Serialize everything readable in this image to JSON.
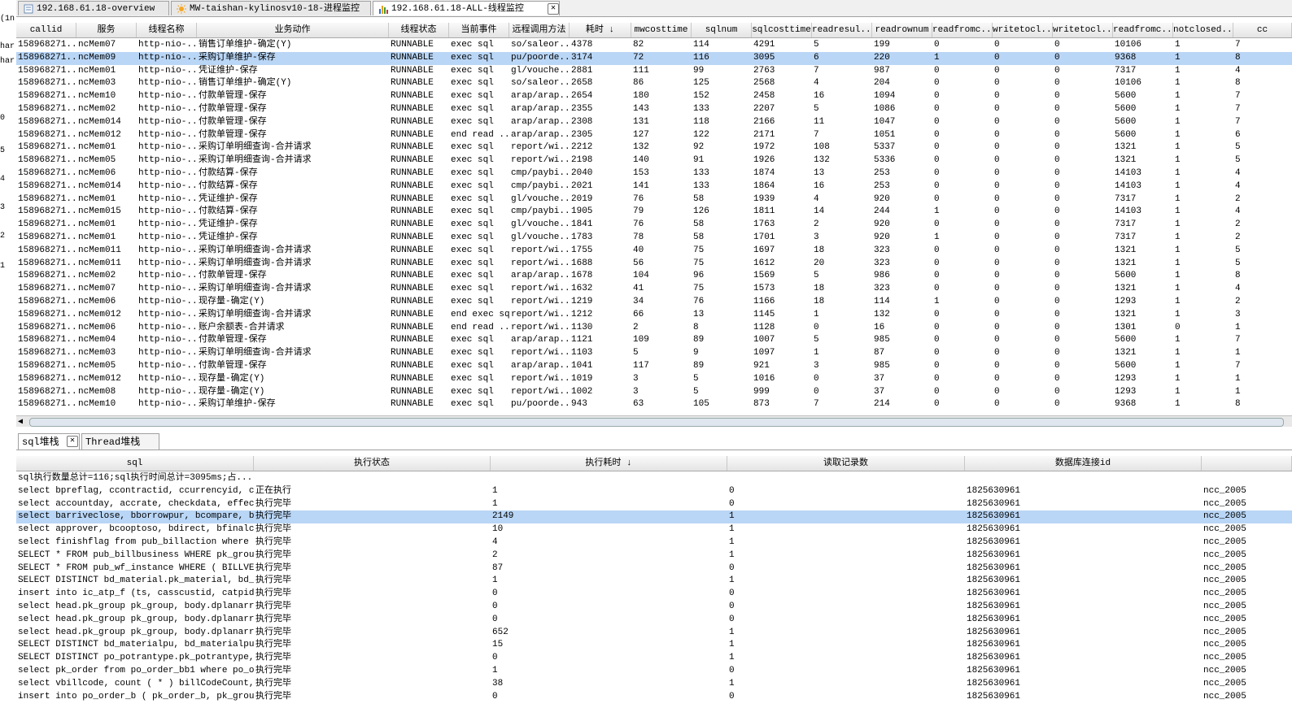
{
  "left_strip": [
    "(1n",
    "har",
    "har",
    "0",
    "5",
    "4",
    "3",
    "2",
    "1"
  ],
  "top_tabs": [
    {
      "label": "192.168.61.18-overview",
      "icon": "overview-icon",
      "active": false
    },
    {
      "label": "MW-taishan-kylinosv10-18-进程监控",
      "icon": "sun-icon",
      "active": false
    },
    {
      "label": "192.168.61.18-ALL-线程监控",
      "icon": "bar-chart-icon",
      "active": true
    }
  ],
  "thread_table": {
    "headers": [
      "callid",
      "服务",
      "线程名称",
      "业务动作",
      "线程状态",
      "当前事件",
      "远程调用方法",
      "耗时 ↓",
      "mwcosttime",
      "sqlnum",
      "sqlcosttime",
      "readresul...",
      "readrownum",
      "readfromc...",
      "writetocl...",
      "writetocl...",
      "readfromc...",
      "notclosed...",
      "cc"
    ],
    "rows": [
      [
        "158968271...",
        "ncMem07",
        "http-nio-...",
        "销售订单维护-确定(Y)",
        "RUNNABLE",
        "exec sql",
        "so/saleor...",
        "4378",
        "82",
        "114",
        "4291",
        "5",
        "199",
        "0",
        "0",
        "0",
        "10106",
        "1",
        "7"
      ],
      [
        "158968271...",
        "ncMem09",
        "http-nio-...",
        "采购订单维护-保存",
        "RUNNABLE",
        "exec sql",
        "pu/poorde...",
        "3174",
        "72",
        "116",
        "3095",
        "6",
        "220",
        "1",
        "0",
        "0",
        "9368",
        "1",
        "8"
      ],
      [
        "158968271...",
        "ncMem01",
        "http-nio-...",
        "凭证维护-保存",
        "RUNNABLE",
        "exec sql",
        "gl/vouche...",
        "2881",
        "111",
        "99",
        "2763",
        "7",
        "987",
        "0",
        "0",
        "0",
        "7317",
        "1",
        "4"
      ],
      [
        "158968271...",
        "ncMem03",
        "http-nio-...",
        "销售订单维护-确定(Y)",
        "RUNNABLE",
        "exec sql",
        "so/saleor...",
        "2658",
        "86",
        "125",
        "2568",
        "4",
        "204",
        "0",
        "0",
        "0",
        "10106",
        "1",
        "8"
      ],
      [
        "158968271...",
        "ncMem10",
        "http-nio-...",
        "付款单管理-保存",
        "RUNNABLE",
        "exec sql",
        "arap/arap...",
        "2654",
        "180",
        "152",
        "2458",
        "16",
        "1094",
        "0",
        "0",
        "0",
        "5600",
        "1",
        "7"
      ],
      [
        "158968271...",
        "ncMem02",
        "http-nio-...",
        "付款单管理-保存",
        "RUNNABLE",
        "exec sql",
        "arap/arap...",
        "2355",
        "143",
        "133",
        "2207",
        "5",
        "1086",
        "0",
        "0",
        "0",
        "5600",
        "1",
        "7"
      ],
      [
        "158968271...",
        "ncMem014",
        "http-nio-...",
        "付款单管理-保存",
        "RUNNABLE",
        "exec sql",
        "arap/arap...",
        "2308",
        "131",
        "118",
        "2166",
        "11",
        "1047",
        "0",
        "0",
        "0",
        "5600",
        "1",
        "7"
      ],
      [
        "158968271...",
        "ncMem012",
        "http-nio-...",
        "付款单管理-保存",
        "RUNNABLE",
        "end read ...",
        "arap/arap...",
        "2305",
        "127",
        "122",
        "2171",
        "7",
        "1051",
        "0",
        "0",
        "0",
        "5600",
        "1",
        "6"
      ],
      [
        "158968271...",
        "ncMem01",
        "http-nio-...",
        "采购订单明细查询-合并请求",
        "RUNNABLE",
        "exec sql",
        "report/wi...",
        "2212",
        "132",
        "92",
        "1972",
        "108",
        "5337",
        "0",
        "0",
        "0",
        "1321",
        "1",
        "5"
      ],
      [
        "158968271...",
        "ncMem05",
        "http-nio-...",
        "采购订单明细查询-合并请求",
        "RUNNABLE",
        "exec sql",
        "report/wi...",
        "2198",
        "140",
        "91",
        "1926",
        "132",
        "5336",
        "0",
        "0",
        "0",
        "1321",
        "1",
        "5"
      ],
      [
        "158968271...",
        "ncMem06",
        "http-nio-...",
        "付款结算-保存",
        "RUNNABLE",
        "exec sql",
        "cmp/paybi...",
        "2040",
        "153",
        "133",
        "1874",
        "13",
        "253",
        "0",
        "0",
        "0",
        "14103",
        "1",
        "4"
      ],
      [
        "158968271...",
        "ncMem014",
        "http-nio-...",
        "付款结算-保存",
        "RUNNABLE",
        "exec sql",
        "cmp/paybi...",
        "2021",
        "141",
        "133",
        "1864",
        "16",
        "253",
        "0",
        "0",
        "0",
        "14103",
        "1",
        "4"
      ],
      [
        "158968271...",
        "ncMem01",
        "http-nio-...",
        "凭证维护-保存",
        "RUNNABLE",
        "exec sql",
        "gl/vouche...",
        "2019",
        "76",
        "58",
        "1939",
        "4",
        "920",
        "0",
        "0",
        "0",
        "7317",
        "1",
        "2"
      ],
      [
        "158968271...",
        "ncMem015",
        "http-nio-...",
        "付款结算-保存",
        "RUNNABLE",
        "exec sql",
        "cmp/paybi...",
        "1905",
        "79",
        "126",
        "1811",
        "14",
        "244",
        "1",
        "0",
        "0",
        "14103",
        "1",
        "4"
      ],
      [
        "158968271...",
        "ncMem01",
        "http-nio-...",
        "凭证维护-保存",
        "RUNNABLE",
        "exec sql",
        "gl/vouche...",
        "1841",
        "76",
        "58",
        "1763",
        "2",
        "920",
        "0",
        "0",
        "0",
        "7317",
        "1",
        "2"
      ],
      [
        "158968271...",
        "ncMem01",
        "http-nio-...",
        "凭证维护-保存",
        "RUNNABLE",
        "exec sql",
        "gl/vouche...",
        "1783",
        "78",
        "58",
        "1701",
        "3",
        "920",
        "1",
        "0",
        "0",
        "7317",
        "1",
        "2"
      ],
      [
        "158968271...",
        "ncMem011",
        "http-nio-...",
        "采购订单明细查询-合并请求",
        "RUNNABLE",
        "exec sql",
        "report/wi...",
        "1755",
        "40",
        "75",
        "1697",
        "18",
        "323",
        "0",
        "0",
        "0",
        "1321",
        "1",
        "5"
      ],
      [
        "158968271...",
        "ncMem011",
        "http-nio-...",
        "采购订单明细查询-合并请求",
        "RUNNABLE",
        "exec sql",
        "report/wi...",
        "1688",
        "56",
        "75",
        "1612",
        "20",
        "323",
        "0",
        "0",
        "0",
        "1321",
        "1",
        "5"
      ],
      [
        "158968271...",
        "ncMem02",
        "http-nio-...",
        "付款单管理-保存",
        "RUNNABLE",
        "exec sql",
        "arap/arap...",
        "1678",
        "104",
        "96",
        "1569",
        "5",
        "986",
        "0",
        "0",
        "0",
        "5600",
        "1",
        "8"
      ],
      [
        "158968271...",
        "ncMem07",
        "http-nio-...",
        "采购订单明细查询-合并请求",
        "RUNNABLE",
        "exec sql",
        "report/wi...",
        "1632",
        "41",
        "75",
        "1573",
        "18",
        "323",
        "0",
        "0",
        "0",
        "1321",
        "1",
        "4"
      ],
      [
        "158968271...",
        "ncMem06",
        "http-nio-...",
        "现存量-确定(Y)",
        "RUNNABLE",
        "exec sql",
        "report/wi...",
        "1219",
        "34",
        "76",
        "1166",
        "18",
        "114",
        "1",
        "0",
        "0",
        "1293",
        "1",
        "2"
      ],
      [
        "158968271...",
        "ncMem012",
        "http-nio-...",
        "采购订单明细查询-合并请求",
        "RUNNABLE",
        "end exec sql",
        "report/wi...",
        "1212",
        "66",
        "13",
        "1145",
        "1",
        "132",
        "0",
        "0",
        "0",
        "1321",
        "1",
        "3"
      ],
      [
        "158968271...",
        "ncMem06",
        "http-nio-...",
        "账户余额表-合并请求",
        "RUNNABLE",
        "end read ...",
        "report/wi...",
        "1130",
        "2",
        "8",
        "1128",
        "0",
        "16",
        "0",
        "0",
        "0",
        "1301",
        "0",
        "1"
      ],
      [
        "158968271...",
        "ncMem04",
        "http-nio-...",
        "付款单管理-保存",
        "RUNNABLE",
        "exec sql",
        "arap/arap...",
        "1121",
        "109",
        "89",
        "1007",
        "5",
        "985",
        "0",
        "0",
        "0",
        "5600",
        "1",
        "7"
      ],
      [
        "158968271...",
        "ncMem03",
        "http-nio-...",
        "采购订单明细查询-合并请求",
        "RUNNABLE",
        "exec sql",
        "report/wi...",
        "1103",
        "5",
        "9",
        "1097",
        "1",
        "87",
        "0",
        "0",
        "0",
        "1321",
        "1",
        "1"
      ],
      [
        "158968271...",
        "ncMem05",
        "http-nio-...",
        "付款单管理-保存",
        "RUNNABLE",
        "exec sql",
        "arap/arap...",
        "1041",
        "117",
        "89",
        "921",
        "3",
        "985",
        "0",
        "0",
        "0",
        "5600",
        "1",
        "7"
      ],
      [
        "158968271...",
        "ncMem012",
        "http-nio-...",
        "现存量-确定(Y)",
        "RUNNABLE",
        "exec sql",
        "report/wi...",
        "1019",
        "3",
        "5",
        "1016",
        "0",
        "37",
        "0",
        "0",
        "0",
        "1293",
        "1",
        "1"
      ],
      [
        "158968271...",
        "ncMem08",
        "http-nio-...",
        "现存量-确定(Y)",
        "RUNNABLE",
        "exec sql",
        "report/wi...",
        "1002",
        "3",
        "5",
        "999",
        "0",
        "37",
        "0",
        "0",
        "0",
        "1293",
        "1",
        "1"
      ],
      [
        "158968271...",
        "ncMem10",
        "http-nio-...",
        "采购订单维护-保存",
        "RUNNABLE",
        "exec sql",
        "pu/poorde...",
        "943",
        "63",
        "105",
        "873",
        "7",
        "214",
        "0",
        "0",
        "0",
        "9368",
        "1",
        "8"
      ]
    ],
    "selected_row": 1
  },
  "bottom_tabs": [
    {
      "label": "sql堆栈",
      "active": true
    },
    {
      "label": "Thread堆栈",
      "active": false
    }
  ],
  "sql_table": {
    "headers": [
      "sql",
      "执行状态",
      "执行耗时 ↓",
      "读取记录数",
      "数据库连接id",
      ""
    ],
    "summary": "sql执行数量总计=116;sql执行时间总计=3095ms;占...",
    "rows": [
      [
        " select bpreflag, ccontractid, ccurrencyid, c...",
        "正在执行",
        "1",
        "0",
        "1825630961",
        "ncc_2005"
      ],
      [
        " select accountday, accrate, checkdata, effec...",
        "执行完毕",
        "1",
        "0",
        "1825630961",
        "ncc_2005"
      ],
      [
        " select barriveclose, bborrowpur, bcompare, b...",
        "执行完毕",
        "2149",
        "1",
        "1825630961",
        "ncc_2005"
      ],
      [
        " select approver, bcooptoso, bdirect, bfinalc...",
        "执行完毕",
        "10",
        "1",
        "1825630961",
        "ncc_2005"
      ],
      [
        "select finishflag from pub_billaction where p...",
        "执行完毕",
        "4",
        "1",
        "1825630961",
        "ncc_2005"
      ],
      [
        "SELECT * FROM pub_billbusiness WHERE pk_group...",
        "执行完毕",
        "2",
        "1",
        "1825630961",
        "ncc_2005"
      ],
      [
        "SELECT * FROM pub_wf_instance WHERE ( BILLVER...",
        "执行完毕",
        "87",
        "0",
        "1825630961",
        "ncc_2005"
      ],
      [
        "SELECT DISTINCT bd_material.pk_material, bd_m...",
        "执行完毕",
        "1",
        "1",
        "1825630961",
        "ncc_2005"
      ],
      [
        "insert into ic_atp_f (ts, casscustid, catpid,...",
        "执行完毕",
        "0",
        "0",
        "1825630961",
        "ncc_2005"
      ],
      [
        "select head.pk_group pk_group, body.dplanarrv...",
        "执行完毕",
        "0",
        "0",
        "1825630961",
        "ncc_2005"
      ],
      [
        "select head.pk_group pk_group, body.dplanarrv...",
        "执行完毕",
        "0",
        "0",
        "1825630961",
        "ncc_2005"
      ],
      [
        "select head.pk_group pk_group, body.dplanarrv...",
        "执行完毕",
        "652",
        "1",
        "1825630961",
        "ncc_2005"
      ],
      [
        "SELECT DISTINCT bd_materialpu, bd_materialpu....",
        "执行完毕",
        "15",
        "1",
        "1825630961",
        "ncc_2005"
      ],
      [
        "SELECT DISTINCT po_potrantype.pk_potrantype, ...",
        "执行完毕",
        "0",
        "1",
        "1825630961",
        "ncc_2005"
      ],
      [
        " select pk_order from po_order_bb1 where po_o...",
        "执行完毕",
        "1",
        "0",
        "1825630961",
        "ncc_2005"
      ],
      [
        " select vbillcode, count ( * ) billCodeCount,...",
        "执行完毕",
        "38",
        "1",
        "1825630961",
        "ncc_2005"
      ],
      [
        "insert into po_order_b ( pk_order_b, pk_group...",
        "执行完毕",
        "0",
        "0",
        "1825630961",
        "ncc_2005"
      ]
    ],
    "selected_row": 2
  },
  "colors": {
    "selected_row": "#b9d6f6",
    "alt_row": "#f3f7fc",
    "header": "#e4e4e4"
  }
}
